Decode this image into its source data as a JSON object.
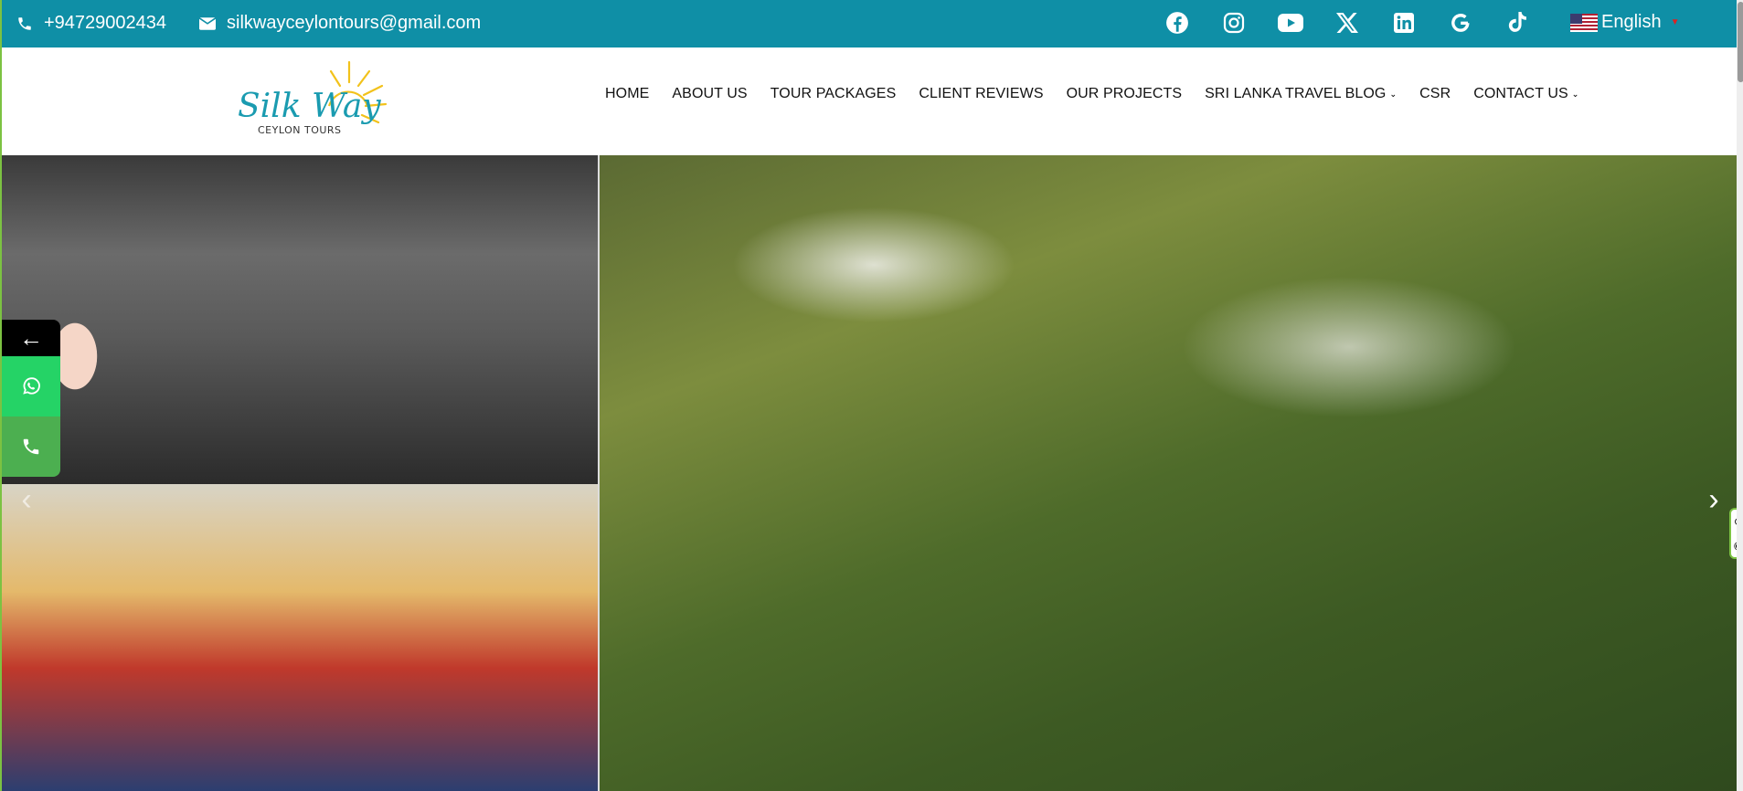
{
  "topbar": {
    "phone": "+94729002434",
    "email": "silkwayceylontours@gmail.com",
    "social_icons": [
      "facebook-icon",
      "instagram-icon",
      "youtube-icon",
      "x-icon",
      "linkedin-icon",
      "google-icon",
      "tiktok-icon"
    ],
    "language": "English",
    "bg_color": "#0f8fa6"
  },
  "logo": {
    "line1": "Silk Way",
    "line2": "CEYLON TOURS"
  },
  "nav": {
    "items": [
      {
        "label": "HOME"
      },
      {
        "label": "ABOUT US"
      },
      {
        "label": "TOUR PACKAGES"
      },
      {
        "label": "CLIENT REVIEWS"
      },
      {
        "label": "OUR PROJECTS"
      },
      {
        "label": "SRI LANKA TRAVEL BLOG"
      },
      {
        "label": "CSR"
      },
      {
        "label": "CONTACT US"
      }
    ]
  },
  "hero": {
    "prev_arrow": "‹",
    "next_arrow": "›"
  },
  "floating": {
    "toggle": "←",
    "whatsapp_color": "#25d366",
    "call_color": "#4caf50"
  }
}
